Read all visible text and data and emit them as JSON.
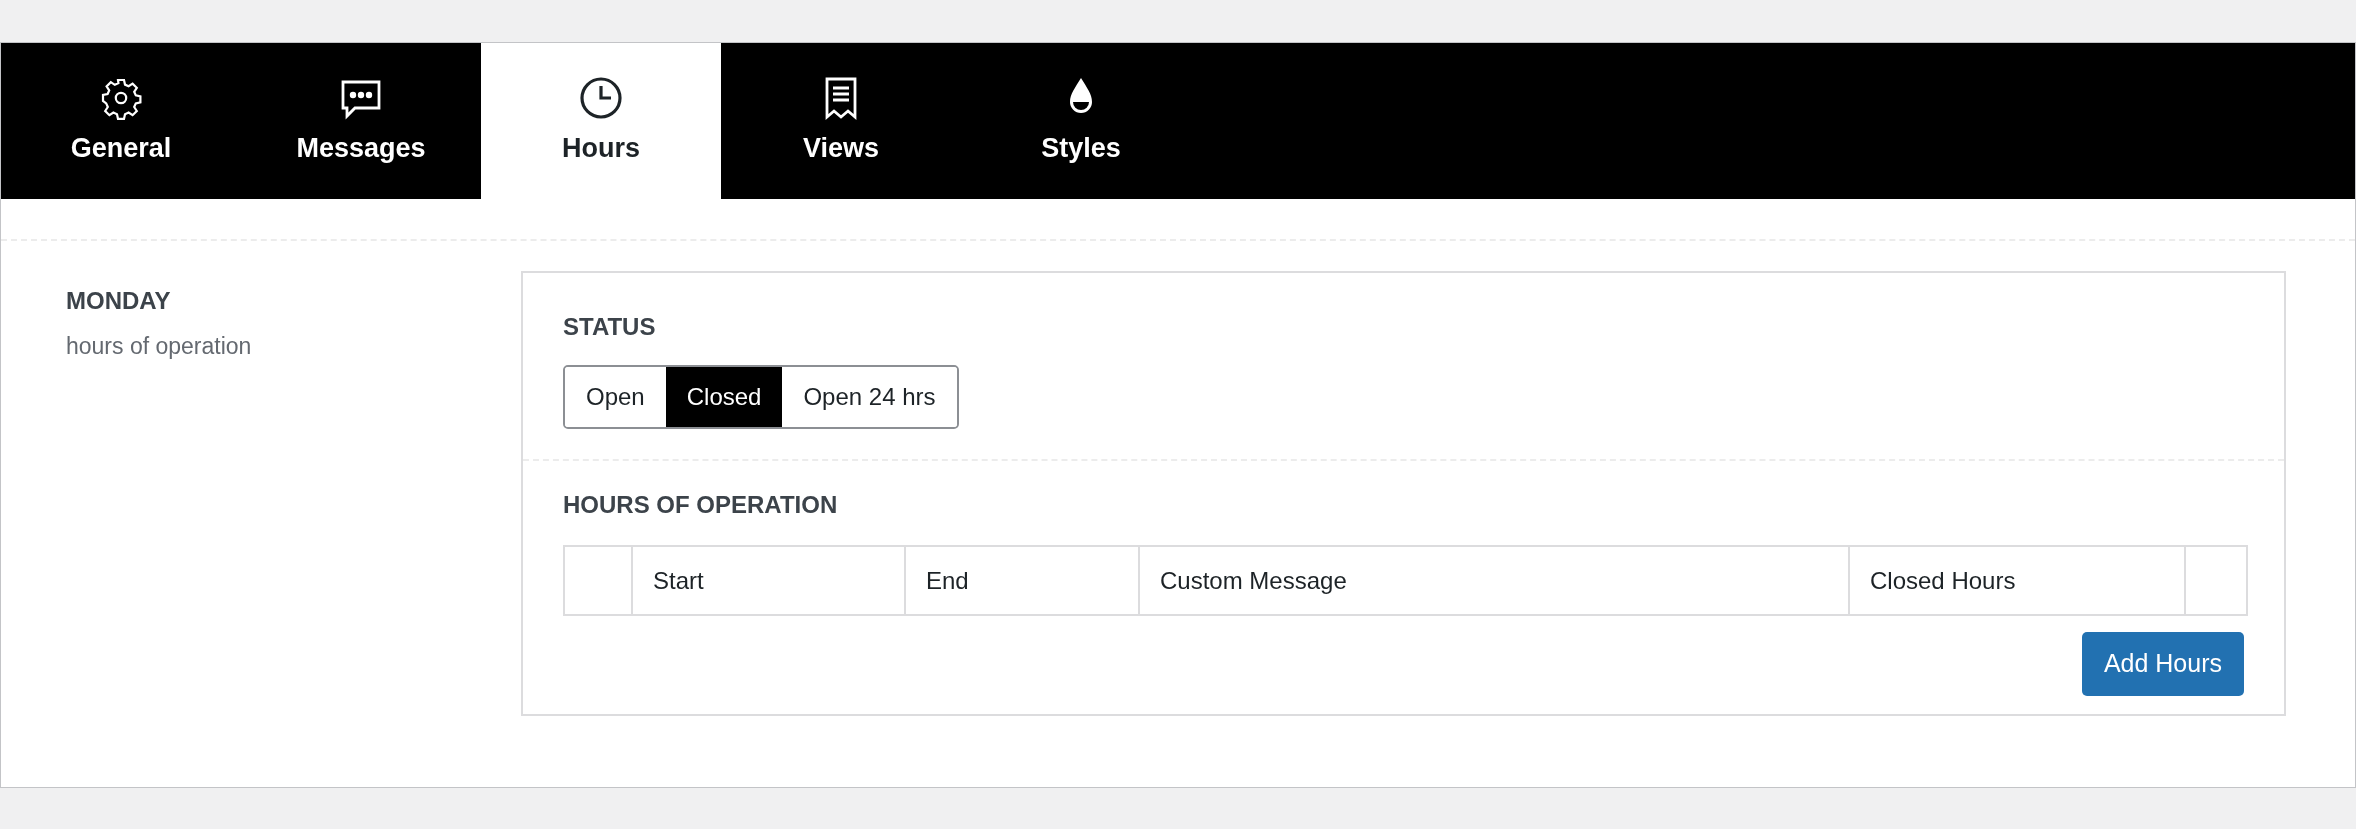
{
  "tabs": [
    {
      "label": "General",
      "kind": "gear",
      "selected": false
    },
    {
      "label": "Messages",
      "kind": "chat",
      "selected": false
    },
    {
      "label": "Hours",
      "kind": "clock",
      "selected": true
    },
    {
      "label": "Views",
      "kind": "receipt",
      "selected": false
    },
    {
      "label": "Styles",
      "kind": "drop",
      "selected": false
    }
  ],
  "day": {
    "title": "MONDAY",
    "subtitle": "hours of operation"
  },
  "status": {
    "heading": "STATUS",
    "options": [
      {
        "label": "Open",
        "selected": false
      },
      {
        "label": "Closed",
        "selected": true
      },
      {
        "label": "Open 24 hrs",
        "selected": false
      }
    ]
  },
  "hours": {
    "heading": "HOURS OF OPERATION",
    "columns": [
      "Start",
      "End",
      "Custom Message",
      "Closed Hours"
    ],
    "button": "Add Hours"
  }
}
